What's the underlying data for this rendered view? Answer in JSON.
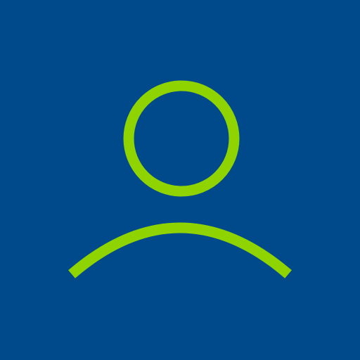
{
  "icon": {
    "name": "user-profile-icon",
    "colors": {
      "background": "#004A8C",
      "stroke": "#8FD300"
    }
  }
}
